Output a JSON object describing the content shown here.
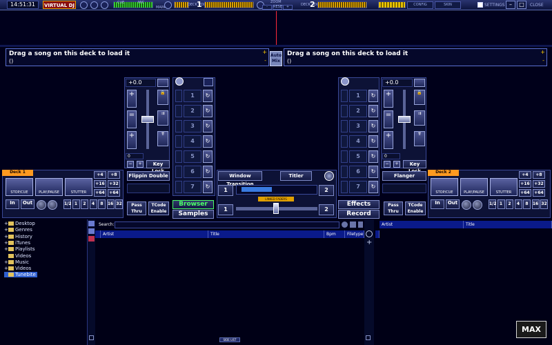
{
  "topbar": {
    "time": "14:51:31",
    "logo": "VIRTUAL DJ",
    "cue_label": "CUE",
    "mic_label": "MIC",
    "main_label": "MAIN",
    "deck_vol_label": "DECK VOL",
    "deck1": "1",
    "deck2": "2",
    "zoom_label": "ZOOM",
    "zoom_reset": "RESET",
    "zoom_minus": "-",
    "zoom_plus": "+",
    "settings": "SETTINGS",
    "close": "CLOSE",
    "skin_btn1": "CONFIG",
    "skin_btn2": "SKIN"
  },
  "load_left": {
    "title": "Drag a song on this deck to load it",
    "subtitle": "()"
  },
  "load_right": {
    "title": "Drag a song on this deck to load it",
    "subtitle": "()"
  },
  "automix": {
    "line1": "Auto",
    "line2": "Mix"
  },
  "deck_left": {
    "pitch": "+0.0",
    "deck_label": "Deck 1",
    "keylock": "Key Lock",
    "pitch_zero": "0",
    "effect": "Flippin Double",
    "pass_thru": "Pass Thru",
    "tcode": "TCode Enable",
    "stop": "STOP/CUE",
    "play": "PLAY/PAUSE",
    "stutter": "STUTTER",
    "in": "In",
    "out": "Out",
    "loops": [
      "1/2",
      "1",
      "2",
      "4",
      "8",
      "16",
      "32"
    ],
    "beats": [
      "+4",
      "+8",
      "+16",
      "+32",
      "+64",
      "+64"
    ],
    "hotcues": [
      "1",
      "2",
      "3",
      "4",
      "5",
      "6",
      "7"
    ]
  },
  "deck_right": {
    "pitch": "+0.0",
    "deck_label": "Deck 2",
    "keylock": "Key Lock",
    "pitch_zero": "0",
    "effect": "Flanger",
    "pass_thru": "Pass Thru",
    "tcode": "TCode Enable",
    "stop": "STOP/CUE",
    "play": "PLAY/PAUSE",
    "stutter": "STUTTER",
    "in": "In",
    "out": "Out",
    "loops": [
      "1/2",
      "1",
      "2",
      "4",
      "8",
      "16",
      "32"
    ],
    "beats": [
      "+4",
      "+8",
      "+16",
      "+32",
      "+64",
      "+64"
    ],
    "hotcues": [
      "1",
      "2",
      "3",
      "4",
      "5",
      "6",
      "7"
    ]
  },
  "center": {
    "window_transition": "Window Transition",
    "titler": "Titler",
    "browser": "Browser",
    "samples": "Samples",
    "effects": "Effects",
    "record": "Record",
    "linked_fader": "LINKED FADERS",
    "trans_left": "1",
    "trans_right": "2",
    "fade_left": "1",
    "fade_right": "2"
  },
  "browser": {
    "search_label": "Search:",
    "columns": [
      "Artist",
      "Title",
      "Bpm",
      "Filetype"
    ],
    "side_columns": [
      "Artist",
      "Title"
    ],
    "side_list": "SIDE LIST",
    "tree": [
      {
        "label": "Desktop",
        "selected": false,
        "expander": "+"
      },
      {
        "label": "Genres",
        "selected": false,
        "expander": "+"
      },
      {
        "label": "History",
        "selected": false,
        "expander": "+"
      },
      {
        "label": "iTunes",
        "selected": false,
        "expander": "+"
      },
      {
        "label": "Playlists",
        "selected": false,
        "expander": "+"
      },
      {
        "label": "Videos",
        "selected": false,
        "expander": ""
      },
      {
        "label": "Music",
        "selected": false,
        "expander": "+"
      },
      {
        "label": "Videos",
        "selected": false,
        "expander": "+"
      },
      {
        "label": "Tunebite",
        "selected": true,
        "expander": ""
      }
    ]
  },
  "max_button": "MAX"
}
